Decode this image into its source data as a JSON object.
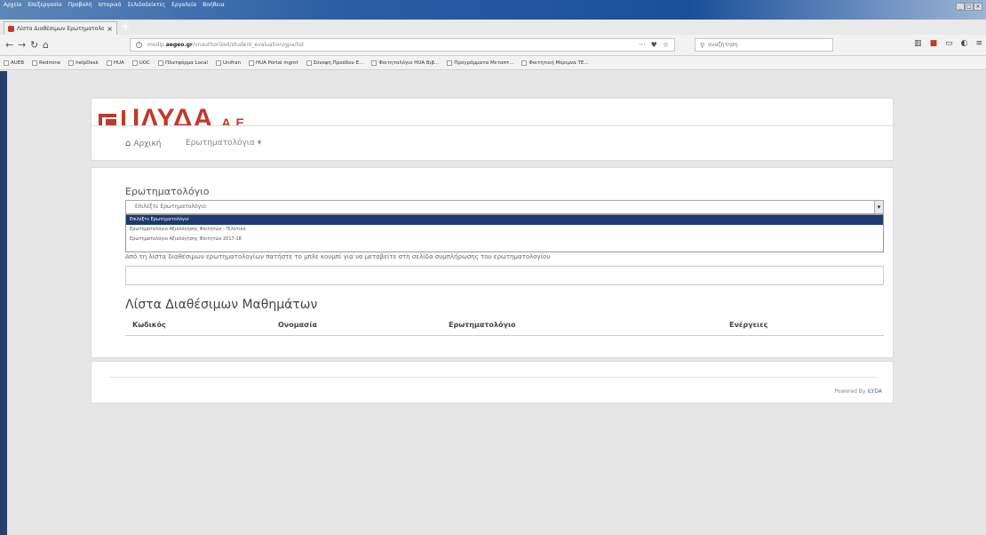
{
  "browser": {
    "menu": [
      "Αρχείο",
      "Επεξεργασία",
      "Προβολή",
      "Ιστορικό",
      "Σελιδοδείκτες",
      "Εργαλεία",
      "Βοήθεια"
    ],
    "tab_title": "Λίστα Διαθέσιμων Ερωτηματολο...",
    "url_prefix": "modip.",
    "url_domain": "aegeo.gr",
    "url_path": "/unauthorized/student_evaluation/gpa/list",
    "search_placeholder": "αναζήτηση",
    "bookmarks": [
      "AUEB",
      "Redmine",
      "helpDesk",
      "HUA",
      "UOC",
      "Πλατφόρμα Local",
      "Unifran",
      "HUA Portal mgmt",
      "Σύνοψη Προόδου Ε...",
      "Φοιτητολόγιο HUA Βιβ...",
      "Προγράμματα Μεταπτ...",
      "Φοιτητική Μέριμνα ΤΕ..."
    ]
  },
  "header": {
    "logo_text": "ΙΛΥΔΑ",
    "logo_suffix": "Α.Ε."
  },
  "nav": {
    "home_label": "Αρχική",
    "questionnaires_label": "Ερωτηματολόγια",
    "questionnaires_caret": "▾"
  },
  "main": {
    "section_label": "Ερωτηματολόγιο",
    "select_value": "Επιλέξτε Ερωτηματολόγιο",
    "options": [
      "Επιλέξτε Ερωτηματολόγιο",
      "Ερωτηματολόγιο Αξιολόγησης Φοιτητών - Πιλοτικό",
      "Ερωτηματολόγιο Αξιολόγησης Φοιτητών 2017-18"
    ],
    "instruction": "Από τη λίστα διαθέσιμων ερωτηματολογίων πατήστε το μπλε κουμπί για να μεταβείτε στη σελίδα συμπλήρωσης του ερωτηματολογίου",
    "list_title": "Λίστα Διαθέσιμων Μαθημάτων",
    "columns": [
      "Κωδικός",
      "Ονομασία",
      "Ερωτηματολόγιο",
      "Ενέργειες"
    ]
  },
  "footer": {
    "powered_prefix": "Powered By",
    "powered_link": "ILYDA"
  },
  "colors": {
    "brand": "#c0392b",
    "selection": "#1e3a6e",
    "link": "#3a6cb0"
  }
}
